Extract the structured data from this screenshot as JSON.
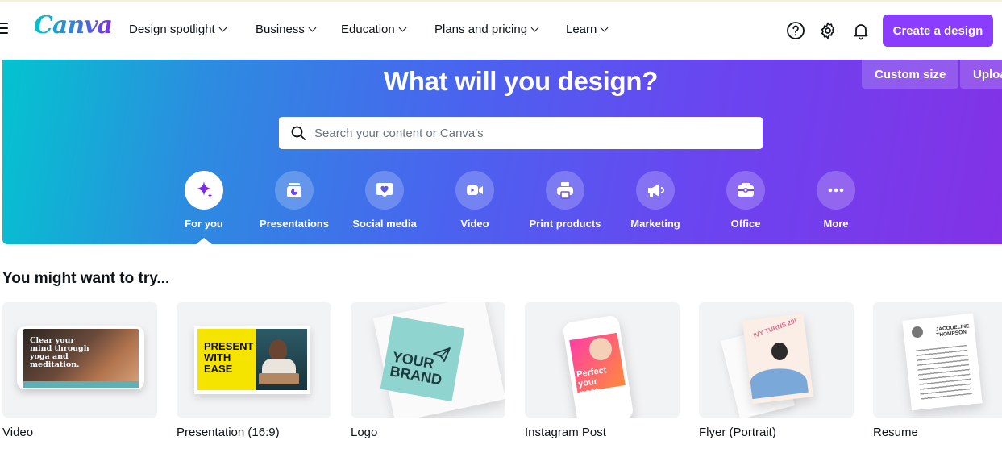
{
  "nav": {
    "logo": "Canva",
    "items": [
      {
        "label": "Design spotlight"
      },
      {
        "label": "Business"
      },
      {
        "label": "Education"
      },
      {
        "label": "Plans and pricing"
      },
      {
        "label": "Learn"
      }
    ],
    "icons": [
      "help-icon",
      "settings-icon",
      "notification-bell-icon"
    ],
    "create_button": "Create a design"
  },
  "hero": {
    "title": "What will you design?",
    "custom_size": "Custom size",
    "upload": "Uploa",
    "search_placeholder": "Search your content or Canva's",
    "categories": [
      {
        "label": "For you",
        "icon": "sparkle-icon",
        "active": true
      },
      {
        "label": "Presentations",
        "icon": "presentation-icon"
      },
      {
        "label": "Social media",
        "icon": "heart-chat-icon"
      },
      {
        "label": "Video",
        "icon": "video-camera-icon"
      },
      {
        "label": "Print products",
        "icon": "printer-icon"
      },
      {
        "label": "Marketing",
        "icon": "megaphone-icon"
      },
      {
        "label": "Office",
        "icon": "briefcase-icon"
      },
      {
        "label": "More",
        "icon": "more-dots-icon"
      }
    ],
    "colors": {
      "start": "#03c4cf",
      "end": "#8431e6",
      "accent": "#8b3dff"
    }
  },
  "try": {
    "title": "You might want to try...",
    "cards": [
      {
        "label": "Video",
        "thumb_text": "Clear your mind through yoga and meditation."
      },
      {
        "label": "Presentation (16:9)",
        "thumb_text": "PRESENT WITH EASE"
      },
      {
        "label": "Logo",
        "thumb_text": "YOUR BRAND"
      },
      {
        "label": "Instagram Post",
        "thumb_text": "Perfect your post"
      },
      {
        "label": "Flyer (Portrait)",
        "thumb_text": "IVY TURNS 20!"
      },
      {
        "label": "Resume",
        "thumb_text": "JACQUELINE THOMPSON"
      }
    ]
  }
}
